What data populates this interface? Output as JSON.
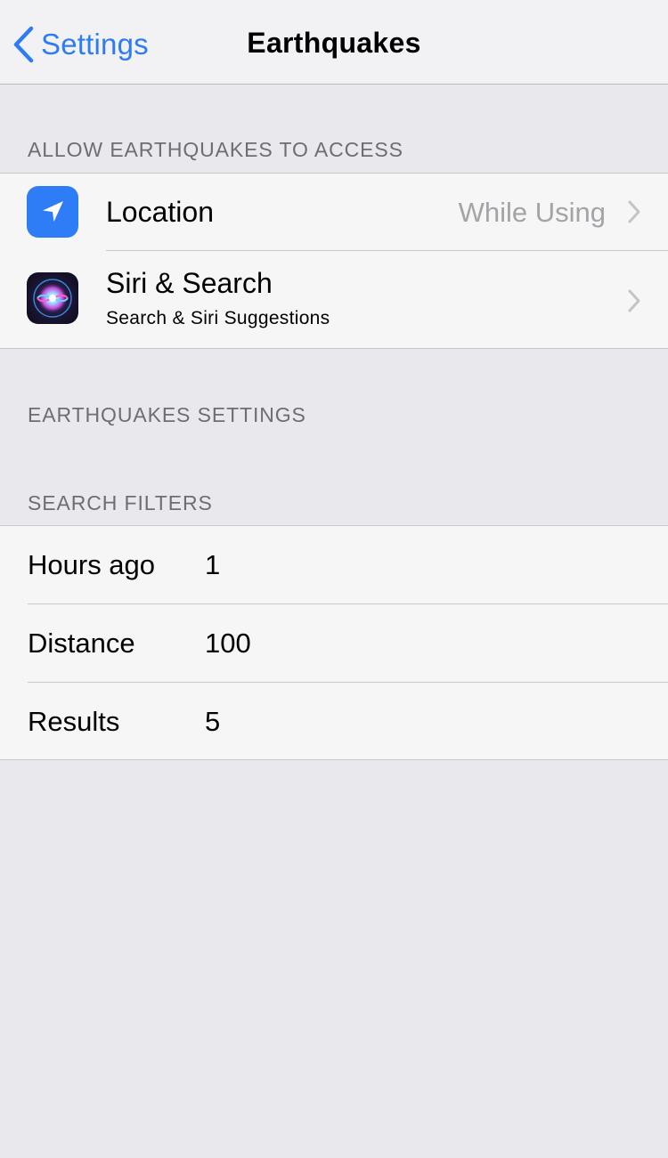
{
  "navbar": {
    "back_label": "Settings",
    "title": "Earthquakes",
    "accent_color": "#2d7cf6"
  },
  "access_section": {
    "header": "ALLOW EARTHQUAKES TO ACCESS",
    "items": [
      {
        "icon": "location-arrow-icon",
        "label": "Location",
        "detail": "While Using"
      },
      {
        "icon": "siri-icon",
        "label": "Siri & Search",
        "subtitle": "Search & Siri Suggestions"
      }
    ]
  },
  "settings_section": {
    "header": "EARTHQUAKES SETTINGS"
  },
  "filters_section": {
    "header": "SEARCH FILTERS",
    "items": [
      {
        "label": "Hours ago",
        "value": "1"
      },
      {
        "label": "Distance",
        "value": "100"
      },
      {
        "label": "Results",
        "value": "5"
      }
    ]
  }
}
